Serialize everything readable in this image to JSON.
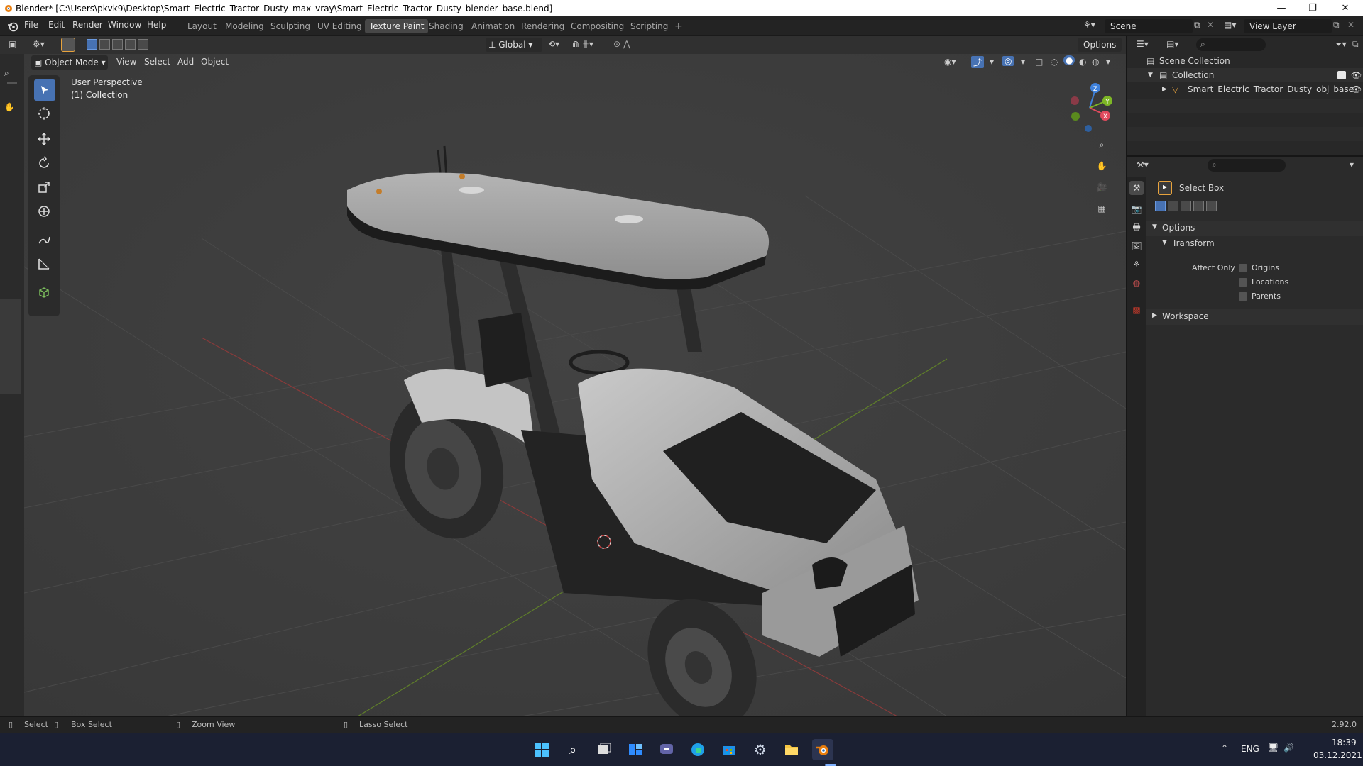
{
  "window": {
    "title": "Blender* [C:\\Users\\pkvk9\\Desktop\\Smart_Electric_Tractor_Dusty_max_vray\\Smart_Electric_Tractor_Dusty_blender_base.blend]",
    "minimize": "—",
    "maximize": "❐",
    "close": "✕"
  },
  "menu": [
    "File",
    "Edit",
    "Render",
    "Window",
    "Help"
  ],
  "workspaces": [
    {
      "label": "Layout",
      "active": false
    },
    {
      "label": "Modeling",
      "active": false
    },
    {
      "label": "Sculpting",
      "active": false
    },
    {
      "label": "UV Editing",
      "active": false
    },
    {
      "label": "Texture Paint",
      "active": true
    },
    {
      "label": "Shading",
      "active": false
    },
    {
      "label": "Animation",
      "active": false
    },
    {
      "label": "Rendering",
      "active": false
    },
    {
      "label": "Compositing",
      "active": false
    },
    {
      "label": "Scripting",
      "active": false
    }
  ],
  "add_workspace": "+",
  "scene_field": "Scene",
  "view_layer_field": "View Layer",
  "tool_header": {
    "transform_orientation": "Global",
    "options": "Options"
  },
  "viewport_header": {
    "mode": "Object Mode",
    "menus": [
      "View",
      "Select",
      "Add",
      "Object"
    ]
  },
  "viewport": {
    "perspective": "User Perspective",
    "collection": "(1) Collection",
    "gizmo_axes": {
      "x": "X",
      "y": "Y",
      "z": "Z"
    }
  },
  "outliner": {
    "scene_collection": "Scene Collection",
    "collection": "Collection",
    "object": "Smart_Electric_Tractor_Dusty_obj_base"
  },
  "properties": {
    "active_tool": "Select Box",
    "options_panel": "Options",
    "transform_panel": "Transform",
    "affect_only_label": "Affect Only",
    "checkboxes": [
      {
        "label": "Origins",
        "checked": false
      },
      {
        "label": "Locations",
        "checked": false
      },
      {
        "label": "Parents",
        "checked": false
      }
    ],
    "workspace_panel": "Workspace"
  },
  "statusbar": {
    "items": [
      "Select",
      "Box Select",
      "Zoom View",
      "Lasso Select"
    ],
    "version": "2.92.0"
  },
  "taskbar": {
    "lang": "ENG",
    "time": "18:39",
    "date": "03.12.2021"
  },
  "colors": {
    "accent": "#4772b3",
    "axis_x": "#e04a5d",
    "axis_y": "#7eb726",
    "axis_z": "#3f82dd"
  }
}
